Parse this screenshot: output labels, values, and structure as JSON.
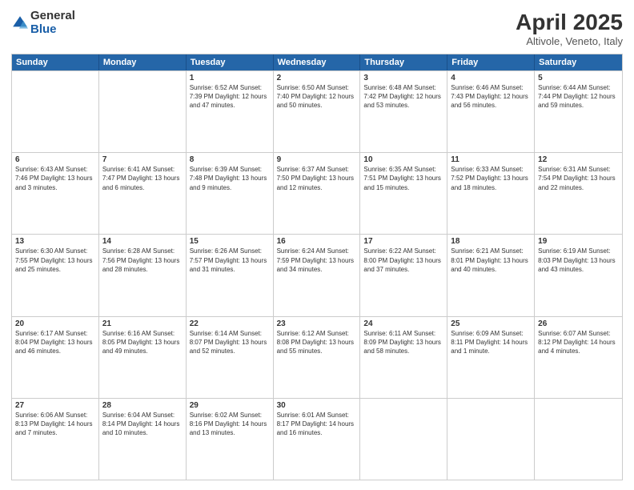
{
  "logo": {
    "general": "General",
    "blue": "Blue"
  },
  "title": "April 2025",
  "subtitle": "Altivole, Veneto, Italy",
  "header_days": [
    "Sunday",
    "Monday",
    "Tuesday",
    "Wednesday",
    "Thursday",
    "Friday",
    "Saturday"
  ],
  "weeks": [
    [
      {
        "day": "",
        "info": ""
      },
      {
        "day": "",
        "info": ""
      },
      {
        "day": "1",
        "info": "Sunrise: 6:52 AM\nSunset: 7:39 PM\nDaylight: 12 hours and 47 minutes."
      },
      {
        "day": "2",
        "info": "Sunrise: 6:50 AM\nSunset: 7:40 PM\nDaylight: 12 hours and 50 minutes."
      },
      {
        "day": "3",
        "info": "Sunrise: 6:48 AM\nSunset: 7:42 PM\nDaylight: 12 hours and 53 minutes."
      },
      {
        "day": "4",
        "info": "Sunrise: 6:46 AM\nSunset: 7:43 PM\nDaylight: 12 hours and 56 minutes."
      },
      {
        "day": "5",
        "info": "Sunrise: 6:44 AM\nSunset: 7:44 PM\nDaylight: 12 hours and 59 minutes."
      }
    ],
    [
      {
        "day": "6",
        "info": "Sunrise: 6:43 AM\nSunset: 7:46 PM\nDaylight: 13 hours and 3 minutes."
      },
      {
        "day": "7",
        "info": "Sunrise: 6:41 AM\nSunset: 7:47 PM\nDaylight: 13 hours and 6 minutes."
      },
      {
        "day": "8",
        "info": "Sunrise: 6:39 AM\nSunset: 7:48 PM\nDaylight: 13 hours and 9 minutes."
      },
      {
        "day": "9",
        "info": "Sunrise: 6:37 AM\nSunset: 7:50 PM\nDaylight: 13 hours and 12 minutes."
      },
      {
        "day": "10",
        "info": "Sunrise: 6:35 AM\nSunset: 7:51 PM\nDaylight: 13 hours and 15 minutes."
      },
      {
        "day": "11",
        "info": "Sunrise: 6:33 AM\nSunset: 7:52 PM\nDaylight: 13 hours and 18 minutes."
      },
      {
        "day": "12",
        "info": "Sunrise: 6:31 AM\nSunset: 7:54 PM\nDaylight: 13 hours and 22 minutes."
      }
    ],
    [
      {
        "day": "13",
        "info": "Sunrise: 6:30 AM\nSunset: 7:55 PM\nDaylight: 13 hours and 25 minutes."
      },
      {
        "day": "14",
        "info": "Sunrise: 6:28 AM\nSunset: 7:56 PM\nDaylight: 13 hours and 28 minutes."
      },
      {
        "day": "15",
        "info": "Sunrise: 6:26 AM\nSunset: 7:57 PM\nDaylight: 13 hours and 31 minutes."
      },
      {
        "day": "16",
        "info": "Sunrise: 6:24 AM\nSunset: 7:59 PM\nDaylight: 13 hours and 34 minutes."
      },
      {
        "day": "17",
        "info": "Sunrise: 6:22 AM\nSunset: 8:00 PM\nDaylight: 13 hours and 37 minutes."
      },
      {
        "day": "18",
        "info": "Sunrise: 6:21 AM\nSunset: 8:01 PM\nDaylight: 13 hours and 40 minutes."
      },
      {
        "day": "19",
        "info": "Sunrise: 6:19 AM\nSunset: 8:03 PM\nDaylight: 13 hours and 43 minutes."
      }
    ],
    [
      {
        "day": "20",
        "info": "Sunrise: 6:17 AM\nSunset: 8:04 PM\nDaylight: 13 hours and 46 minutes."
      },
      {
        "day": "21",
        "info": "Sunrise: 6:16 AM\nSunset: 8:05 PM\nDaylight: 13 hours and 49 minutes."
      },
      {
        "day": "22",
        "info": "Sunrise: 6:14 AM\nSunset: 8:07 PM\nDaylight: 13 hours and 52 minutes."
      },
      {
        "day": "23",
        "info": "Sunrise: 6:12 AM\nSunset: 8:08 PM\nDaylight: 13 hours and 55 minutes."
      },
      {
        "day": "24",
        "info": "Sunrise: 6:11 AM\nSunset: 8:09 PM\nDaylight: 13 hours and 58 minutes."
      },
      {
        "day": "25",
        "info": "Sunrise: 6:09 AM\nSunset: 8:11 PM\nDaylight: 14 hours and 1 minute."
      },
      {
        "day": "26",
        "info": "Sunrise: 6:07 AM\nSunset: 8:12 PM\nDaylight: 14 hours and 4 minutes."
      }
    ],
    [
      {
        "day": "27",
        "info": "Sunrise: 6:06 AM\nSunset: 8:13 PM\nDaylight: 14 hours and 7 minutes."
      },
      {
        "day": "28",
        "info": "Sunrise: 6:04 AM\nSunset: 8:14 PM\nDaylight: 14 hours and 10 minutes."
      },
      {
        "day": "29",
        "info": "Sunrise: 6:02 AM\nSunset: 8:16 PM\nDaylight: 14 hours and 13 minutes."
      },
      {
        "day": "30",
        "info": "Sunrise: 6:01 AM\nSunset: 8:17 PM\nDaylight: 14 hours and 16 minutes."
      },
      {
        "day": "",
        "info": ""
      },
      {
        "day": "",
        "info": ""
      },
      {
        "day": "",
        "info": ""
      }
    ]
  ]
}
